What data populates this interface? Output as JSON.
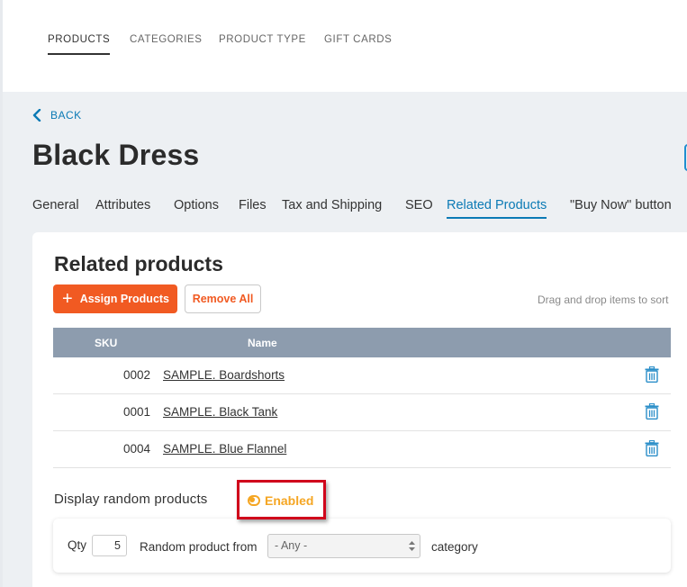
{
  "top_tabs": [
    {
      "label": "PRODUCTS",
      "active": true
    },
    {
      "label": "CATEGORIES",
      "active": false
    },
    {
      "label": "PRODUCT TYPE",
      "active": false
    },
    {
      "label": "GIFT CARDS",
      "active": false
    }
  ],
  "back_label": "BACK",
  "page_title": "Black Dress",
  "sub_tabs": [
    {
      "label": "General",
      "active": false
    },
    {
      "label": "Attributes",
      "active": false
    },
    {
      "label": "Options",
      "active": false
    },
    {
      "label": "Files",
      "active": false
    },
    {
      "label": "Tax and Shipping",
      "active": false
    },
    {
      "label": "SEO",
      "active": false
    },
    {
      "label": "Related Products",
      "active": true
    },
    {
      "label": "\"Buy Now\" button",
      "active": false
    }
  ],
  "related": {
    "title": "Related products",
    "assign_label": "Assign Products",
    "remove_all_label": "Remove All",
    "drag_hint": "Drag and drop items to sort",
    "columns": {
      "sku": "SKU",
      "name": "Name"
    },
    "rows": [
      {
        "sku": "0002",
        "name": "SAMPLE. Boardshorts"
      },
      {
        "sku": "0001",
        "name": "SAMPLE. Black Tank"
      },
      {
        "sku": "0004",
        "name": "SAMPLE. Blue Flannel"
      }
    ]
  },
  "random": {
    "label": "Display random products",
    "status": "Enabled",
    "qty_label": "Qty",
    "qty_value": "5",
    "from_label": "Random product from",
    "select_value": "- Any -",
    "category_label": "category"
  },
  "colors": {
    "accent_orange": "#f15a22",
    "link_blue": "#0b7ab5",
    "enabled_yellow": "#f5a623",
    "table_header": "#8d9cae",
    "highlight_red": "#d0021b"
  }
}
